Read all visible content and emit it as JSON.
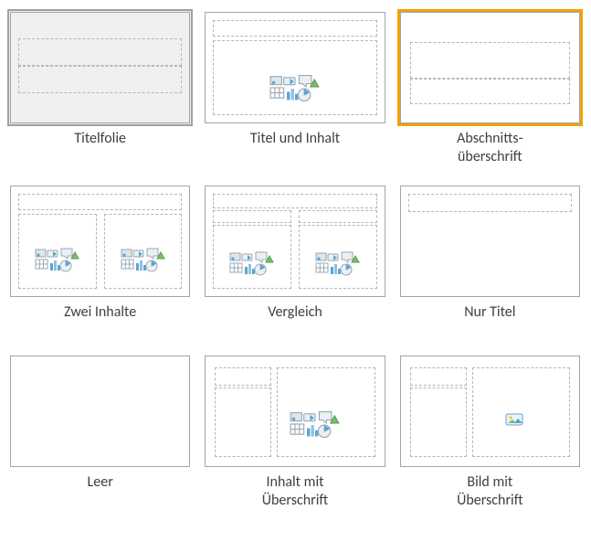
{
  "layouts": [
    {
      "id": "titelfolie",
      "label": "Titelfolie",
      "selected": true,
      "highlighted": false
    },
    {
      "id": "titel-inhalt",
      "label": "Titel und Inhalt",
      "selected": false,
      "highlighted": false
    },
    {
      "id": "abschnitt",
      "label": "Abschnitts-\nüberschrift",
      "selected": false,
      "highlighted": true
    },
    {
      "id": "zwei",
      "label": "Zwei Inhalte",
      "selected": false,
      "highlighted": false
    },
    {
      "id": "vergleich",
      "label": "Vergleich",
      "selected": false,
      "highlighted": false
    },
    {
      "id": "nurtitel",
      "label": "Nur Titel",
      "selected": false,
      "highlighted": false
    },
    {
      "id": "leer",
      "label": "Leer",
      "selected": false,
      "highlighted": false
    },
    {
      "id": "inhalt-u",
      "label": "Inhalt mit\nÜberschrift",
      "selected": false,
      "highlighted": false
    },
    {
      "id": "bild-u",
      "label": "Bild mit\nÜberschrift",
      "selected": false,
      "highlighted": false
    }
  ]
}
